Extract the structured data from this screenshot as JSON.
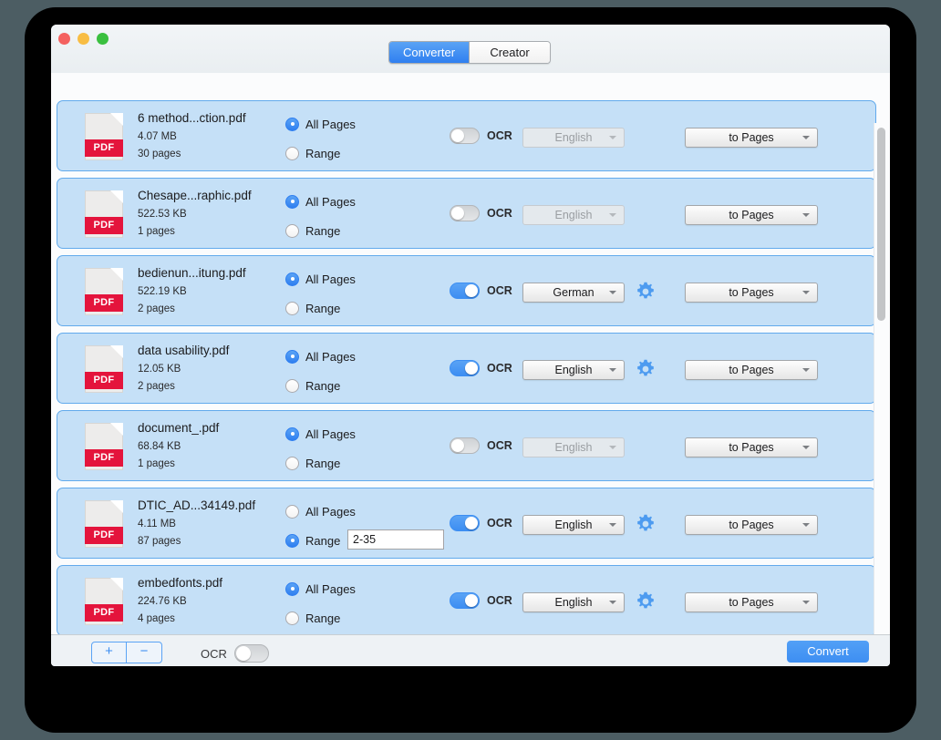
{
  "window": {
    "traffic_lights": [
      "close",
      "minimize",
      "zoom"
    ],
    "tabs": [
      {
        "label": "Converter",
        "active": true
      },
      {
        "label": "Creator",
        "active": false
      }
    ]
  },
  "labels": {
    "all_pages": "All Pages",
    "range": "Range",
    "ocr": "OCR",
    "file_type_badge": "PDF"
  },
  "files": [
    {
      "name": "6 method...ction.pdf",
      "size": "4.07 MB",
      "pages": "30 pages",
      "all_pages_selected": true,
      "range_selected": false,
      "range_value": "",
      "ocr_enabled": false,
      "language": "English",
      "output": "to Pages"
    },
    {
      "name": "Chesape...raphic.pdf",
      "size": "522.53 KB",
      "pages": "1 pages",
      "all_pages_selected": true,
      "range_selected": false,
      "range_value": "",
      "ocr_enabled": false,
      "language": "English",
      "output": "to Pages"
    },
    {
      "name": "bedienun...itung.pdf",
      "size": "522.19 KB",
      "pages": "2 pages",
      "all_pages_selected": true,
      "range_selected": false,
      "range_value": "",
      "ocr_enabled": true,
      "language": "German",
      "output": "to Pages"
    },
    {
      "name": "data usability.pdf",
      "size": "12.05 KB",
      "pages": "2 pages",
      "all_pages_selected": true,
      "range_selected": false,
      "range_value": "",
      "ocr_enabled": true,
      "language": "English",
      "output": "to Pages"
    },
    {
      "name": "document_.pdf",
      "size": "68.84 KB",
      "pages": "1 pages",
      "all_pages_selected": true,
      "range_selected": false,
      "range_value": "",
      "ocr_enabled": false,
      "language": "English",
      "output": "to Pages"
    },
    {
      "name": "DTIC_AD...34149.pdf",
      "size": "4.11 MB",
      "pages": "87 pages",
      "all_pages_selected": false,
      "range_selected": true,
      "range_value": "2-35",
      "ocr_enabled": true,
      "language": "English",
      "output": "to Pages"
    },
    {
      "name": "embedfonts.pdf",
      "size": "224.76 KB",
      "pages": "4 pages",
      "all_pages_selected": true,
      "range_selected": false,
      "range_value": "",
      "ocr_enabled": true,
      "language": "English",
      "output": "to Pages"
    }
  ],
  "bottom_bar": {
    "add_label": "+",
    "remove_label": "−",
    "ocr_label": "OCR",
    "ocr_enabled": false,
    "convert_label": "Convert"
  },
  "colors": {
    "accent": "#3d8ef2",
    "row_background": "#c5e0f7",
    "row_border": "#62aaec",
    "pdf_badge": "#e4143c",
    "window_chrome": "#eef2f5"
  }
}
